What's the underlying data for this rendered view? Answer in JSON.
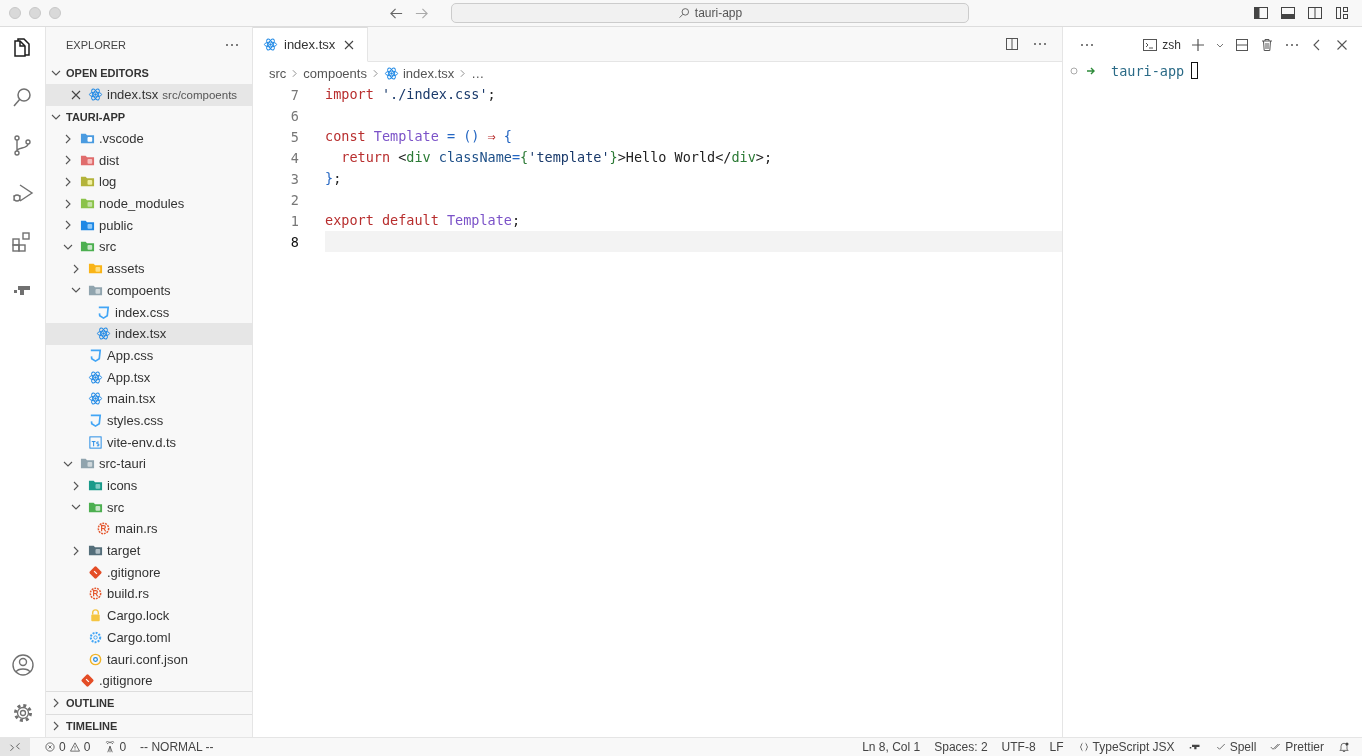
{
  "window": {
    "search": "tauri-app"
  },
  "activity_bar": {
    "top": [
      {
        "kind": "files",
        "selected": true
      },
      {
        "kind": "search",
        "selected": false
      },
      {
        "kind": "source-control",
        "selected": false
      },
      {
        "kind": "debug",
        "selected": false
      },
      {
        "kind": "extensions",
        "selected": false
      },
      {
        "kind": "remote",
        "selected": false
      }
    ],
    "bottom": [
      {
        "kind": "account"
      },
      {
        "kind": "settings"
      }
    ]
  },
  "sidebar": {
    "title": "EXPLORER",
    "open_editors": {
      "title": "OPEN EDITORS",
      "expanded": true,
      "items": [
        {
          "name": "index.tsx",
          "path": "src/compoents",
          "kind": "react",
          "selected": true
        }
      ]
    },
    "project": {
      "title": "TAURI-APP",
      "expanded": true,
      "items": [
        {
          "name": ".vscode",
          "kind": "folder-vscode",
          "expanded": false
        },
        {
          "name": "dist",
          "kind": "folder-dist",
          "expanded": false
        },
        {
          "name": "log",
          "kind": "folder-log",
          "expanded": false
        },
        {
          "name": "node_modules",
          "kind": "folder-node",
          "expanded": false
        },
        {
          "name": "public",
          "kind": "folder-public",
          "expanded": false
        },
        {
          "name": "src",
          "kind": "folder-src",
          "expanded": true,
          "children": [
            {
              "name": "assets",
              "kind": "folder-assets",
              "expanded": false
            },
            {
              "name": "compoents",
              "kind": "folder",
              "expanded": true,
              "children": [
                {
                  "name": "index.css",
                  "kind": "css",
                  "selected": false
                },
                {
                  "name": "index.tsx",
                  "kind": "react",
                  "selected": true
                }
              ]
            },
            {
              "name": "App.css",
              "kind": "css",
              "selected": false
            },
            {
              "name": "App.tsx",
              "kind": "react",
              "selected": false
            },
            {
              "name": "main.tsx",
              "kind": "react",
              "selected": false
            },
            {
              "name": "styles.css",
              "kind": "css",
              "selected": false
            },
            {
              "name": "vite-env.d.ts",
              "kind": "ts",
              "selected": false
            }
          ]
        },
        {
          "name": "src-tauri",
          "kind": "folder",
          "expanded": true,
          "children": [
            {
              "name": "icons",
              "kind": "folder-icons",
              "expanded": false
            },
            {
              "name": "src",
              "kind": "folder-src",
              "expanded": true,
              "children": [
                {
                  "name": "main.rs",
                  "kind": "rust",
                  "selected": false
                }
              ]
            },
            {
              "name": "target",
              "kind": "folder-target",
              "expanded": false
            },
            {
              "name": ".gitignore",
              "kind": "git",
              "selected": false
            },
            {
              "name": "build.rs",
              "kind": "rust",
              "selected": false
            },
            {
              "name": "Cargo.lock",
              "kind": "lock",
              "selected": false
            },
            {
              "name": "Cargo.toml",
              "kind": "toml",
              "selected": false
            },
            {
              "name": "tauri.conf.json",
              "kind": "json",
              "selected": false
            }
          ]
        },
        {
          "name": ".gitignore",
          "kind": "git",
          "selected": false
        }
      ]
    },
    "sections": [
      {
        "title": "OUTLINE",
        "expanded": false
      },
      {
        "title": "TIMELINE",
        "expanded": false
      }
    ]
  },
  "editor": {
    "tabs": [
      {
        "label": "index.tsx",
        "kind": "react",
        "selected": true
      }
    ],
    "breadcrumb": [
      {
        "label": "src"
      },
      {
        "label": "compoents"
      },
      {
        "label": "index.tsx",
        "kind": "react"
      },
      {
        "label": "…"
      }
    ],
    "lines": [
      {
        "number": "7",
        "current": false,
        "tokens": [
          {
            "t": "import",
            "kind": "keyword"
          },
          {
            "t": " './index.css'",
            "kind": "string"
          },
          {
            "t": ";",
            "kind": "plain"
          }
        ]
      },
      {
        "number": "6",
        "current": false
      },
      {
        "number": "5",
        "current": false,
        "tokens": [
          {
            "t": "const",
            "kind": "keyword"
          },
          {
            "t": " Template",
            "kind": "func"
          },
          {
            "t": " = ()",
            "kind": "brace"
          },
          {
            "t": " ⇒",
            "kind": "keyword"
          },
          {
            "t": " {",
            "kind": "brace"
          }
        ]
      },
      {
        "number": "4",
        "current": false,
        "tokens": [
          {
            "t": "  return",
            "kind": "keyword"
          },
          {
            "t": " <",
            "kind": "plain"
          },
          {
            "t": "div",
            "kind": "tag"
          },
          {
            "t": " className",
            "kind": "attr"
          },
          {
            "t": "=",
            "kind": "brace"
          },
          {
            "t": "{",
            "kind": "tag"
          },
          {
            "t": "'template'",
            "kind": "string"
          },
          {
            "t": "}",
            "kind": "tag"
          },
          {
            "t": ">Hello World</",
            "kind": "plain"
          },
          {
            "t": "div",
            "kind": "tag"
          },
          {
            "t": ">;",
            "kind": "plain"
          }
        ]
      },
      {
        "number": "3",
        "current": false,
        "tokens": [
          {
            "t": "}",
            "kind": "brace"
          },
          {
            "t": ";",
            "kind": "plain"
          }
        ]
      },
      {
        "number": "2",
        "current": false
      },
      {
        "number": "1",
        "current": false,
        "tokens": [
          {
            "t": "export default",
            "kind": "keyword"
          },
          {
            "t": " Template",
            "kind": "func"
          },
          {
            "t": ";",
            "kind": "plain"
          }
        ]
      },
      {
        "number": "8",
        "current": true
      }
    ]
  },
  "terminal": {
    "shell": "zsh",
    "prompt": "tauri-app"
  },
  "status_bar": {
    "errors": "0",
    "warnings": "0",
    "ports": "0",
    "mode": "-- NORMAL --",
    "position": "Ln 8, Col 1",
    "spaces": "Spaces: 2",
    "encoding": "UTF-8",
    "eol": "LF",
    "language": "TypeScript JSX",
    "spell": "Spell",
    "formatter": "Prettier"
  }
}
